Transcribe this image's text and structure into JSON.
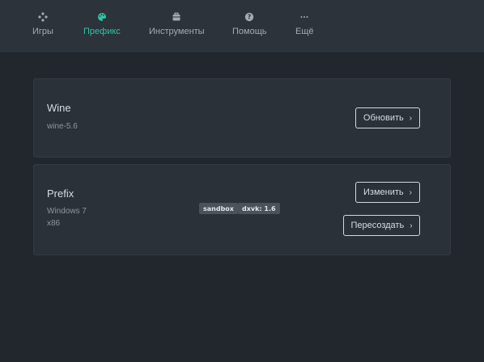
{
  "nav": {
    "games": {
      "label": "Игры",
      "icon": "gamepad-icon"
    },
    "prefix": {
      "label": "Префикс",
      "icon": "palette-icon"
    },
    "tools": {
      "label": "Инструменты",
      "icon": "toolbox-icon"
    },
    "help": {
      "label": "Помощь",
      "icon": "help-icon"
    },
    "more": {
      "label": "Ещё",
      "icon": "more-icon"
    }
  },
  "accent_color": "#2ec4a7",
  "wine_card": {
    "title": "Wine",
    "version": "wine-5.6",
    "update_button": "Обновить"
  },
  "prefix_card": {
    "title": "Prefix",
    "windows_version": "Windows 7",
    "arch": "x86",
    "badges": [
      "sandbox",
      "dxvk: 1.6"
    ],
    "change_button": "Изменить",
    "recreate_button": "Пересоздать"
  }
}
